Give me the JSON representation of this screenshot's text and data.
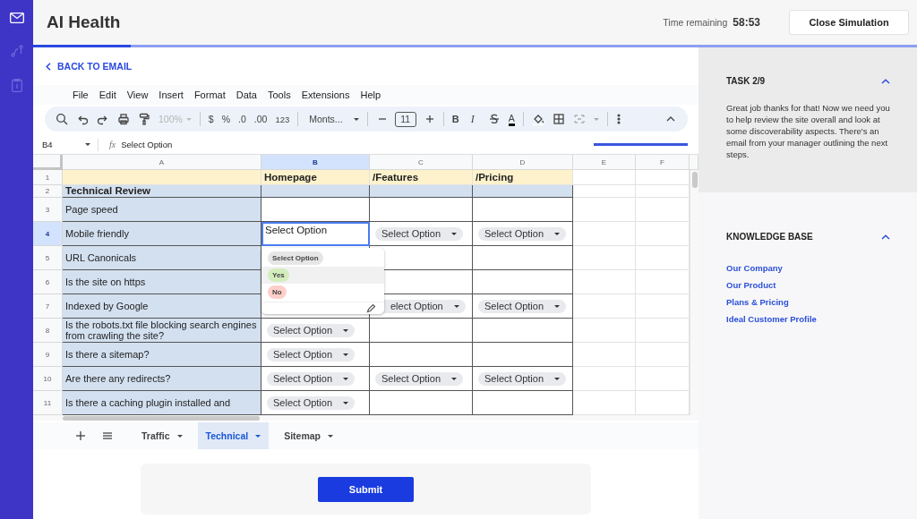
{
  "rail": {
    "items": [
      {
        "selected": true
      },
      {
        "selected": false
      },
      {
        "selected": false
      }
    ]
  },
  "header": {
    "title": "AI Health",
    "time_label": "Time remaining",
    "time_value": "58:53",
    "close_button": "Close Simulation"
  },
  "progress": {
    "level": 0.11
  },
  "back_link": "BACK TO EMAIL",
  "menu": [
    "File",
    "Edit",
    "View",
    "Insert",
    "Format",
    "Data",
    "Tools",
    "Extensions",
    "Help"
  ],
  "toolbar": {
    "zoom": {
      "text": "100%",
      "disabled": true
    },
    "currency": "$",
    "percent": "%",
    "decrease_decimal": ".0",
    "increase_decimal": ".00",
    "number_format": "123",
    "font": "Monts...",
    "font_size": "11",
    "bold": "B",
    "italic": "I",
    "text_color": "A",
    "merge_disabled": true
  },
  "formula_bar": {
    "cell": "B4",
    "function_symbol": "fx",
    "value": "Select Option"
  },
  "sheet": {
    "columns": [
      {
        "letter": "A",
        "selected": false
      },
      {
        "letter": "B",
        "selected": true
      },
      {
        "letter": "C",
        "selected": false
      },
      {
        "letter": "D",
        "selected": false
      },
      {
        "letter": "E",
        "selected": false
      },
      {
        "letter": "F",
        "selected": false
      }
    ],
    "rows": [
      {
        "number": "1",
        "selected": false,
        "kind": "titles",
        "cells": {
          "b": {
            "kind": "text",
            "text": "Homepage"
          },
          "c": {
            "kind": "text",
            "text": "/Features"
          },
          "d": {
            "kind": "text",
            "text": "/Pricing"
          }
        }
      },
      {
        "number": "2",
        "selected": false,
        "kind": "section",
        "label": "Technical Review"
      },
      {
        "number": "3",
        "selected": false,
        "kind": "item",
        "label": "Page speed"
      },
      {
        "number": "4",
        "selected": true,
        "kind": "item",
        "label": "Mobile friendly",
        "cells": {
          "b": {
            "kind": "editing",
            "text": "Select Option"
          },
          "c": {
            "kind": "dropdown",
            "text": "Select Option"
          },
          "d": {
            "kind": "dropdown",
            "text": "Select Option"
          }
        }
      },
      {
        "number": "5",
        "selected": false,
        "kind": "item",
        "label": "URL Canonicals"
      },
      {
        "number": "6",
        "selected": false,
        "kind": "item",
        "label": "Is the site on https"
      },
      {
        "number": "7",
        "selected": false,
        "kind": "item",
        "label": "Indexed by Google",
        "cells": {
          "c": {
            "kind": "dropdown",
            "text": "elect Option",
            "covered": true
          },
          "d": {
            "kind": "dropdown",
            "text": "Select Option"
          }
        }
      },
      {
        "number": "8",
        "selected": false,
        "kind": "item",
        "label": "Is the robots.txt file blocking search engines from crawling the site?",
        "cells": {
          "b": {
            "kind": "dropdown",
            "text": "Select Option"
          }
        }
      },
      {
        "number": "9",
        "selected": false,
        "kind": "item",
        "label": "Is there a sitemap?",
        "cells": {
          "b": {
            "kind": "dropdown",
            "text": "Select Option"
          }
        }
      },
      {
        "number": "10",
        "selected": false,
        "kind": "item",
        "label": "Are there any redirects?",
        "cells": {
          "b": {
            "kind": "dropdown",
            "text": "Select Option"
          },
          "c": {
            "kind": "dropdown",
            "text": "Select Option"
          },
          "d": {
            "kind": "dropdown",
            "text": "Select Option"
          }
        }
      },
      {
        "number": "11",
        "selected": false,
        "kind": "item",
        "label": "Is there a caching plugin installed and",
        "cells": {
          "b": {
            "kind": "dropdown",
            "text": "Select Option"
          }
        }
      }
    ],
    "dropdown": {
      "options": [
        {
          "text": "Select Option",
          "color": "#e6e6e6",
          "highlighted": false
        },
        {
          "text": "Yes",
          "color": "#d4edbc",
          "highlighted": true
        },
        {
          "text": "No",
          "color": "#ffcfc9",
          "highlighted": false
        }
      ]
    }
  },
  "sheet_tabs": [
    {
      "label": "Traffic",
      "selected": false
    },
    {
      "label": "Technical",
      "selected": true
    },
    {
      "label": "Sitemap",
      "selected": false
    }
  ],
  "submit_button": "Submit",
  "side_sections": [
    {
      "kind": "task",
      "title": "TASK 2/9",
      "expanded": true,
      "body": "Great job thanks for that! Now we need you to help review the site overall and look at some discoverability aspects. There's an email from your manager outlining the next steps."
    },
    {
      "kind": "links",
      "title": "KNOWLEDGE BASE",
      "expanded": true,
      "links": [
        "Our Company",
        "Our Product",
        "Plans & Pricing",
        "Ideal Customer Profile"
      ]
    }
  ]
}
